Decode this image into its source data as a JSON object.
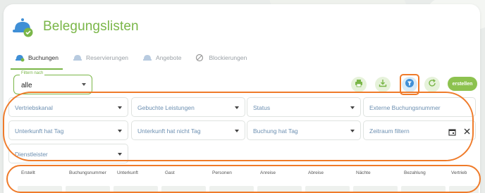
{
  "page": {
    "title": "Belegungslisten"
  },
  "tabs": [
    {
      "label": "Buchungen",
      "active": true,
      "icon": "bell-icon"
    },
    {
      "label": "Reservierungen",
      "active": false,
      "icon": "bell-icon"
    },
    {
      "label": "Angebote",
      "active": false,
      "icon": "bell-icon"
    },
    {
      "label": "Blockierungen",
      "active": false,
      "icon": "block-icon"
    }
  ],
  "filter_select": {
    "label": "Filtern nach",
    "value": "alle"
  },
  "actions": {
    "print_icon": "print-icon",
    "download_icon": "download-icon",
    "filter_icon": "filter-icon",
    "refresh_icon": "refresh-icon",
    "create_label": "erstellen"
  },
  "filters": {
    "vertriebskanal": "Vertriebskanal",
    "gebuchte_leistungen": "Gebuchte Leistungen",
    "status": "Status",
    "externe_buchungsnummer": "Externe Buchungsnummer",
    "unterkunft_hat_tag": "Unterkunft hat Tag",
    "unterkunft_hat_nicht_tag": "Unterkunft hat nicht Tag",
    "buchung_hat_tag": "Buchung hat Tag",
    "zeitraum_filtern": "Zeitraum filtern",
    "dienstleister": "Dienstleister"
  },
  "table": {
    "columns": [
      "Erstellt",
      "Buchungsnummer",
      "Unterkunft",
      "Gast",
      "Personen",
      "Anreise",
      "Abreise",
      "Nächte",
      "Bezahlung",
      "Vertrieb"
    ]
  },
  "colors": {
    "brand_green": "#7ab648",
    "highlight_orange": "#ef7b2a",
    "placeholder_blue": "#6c8fb1"
  }
}
